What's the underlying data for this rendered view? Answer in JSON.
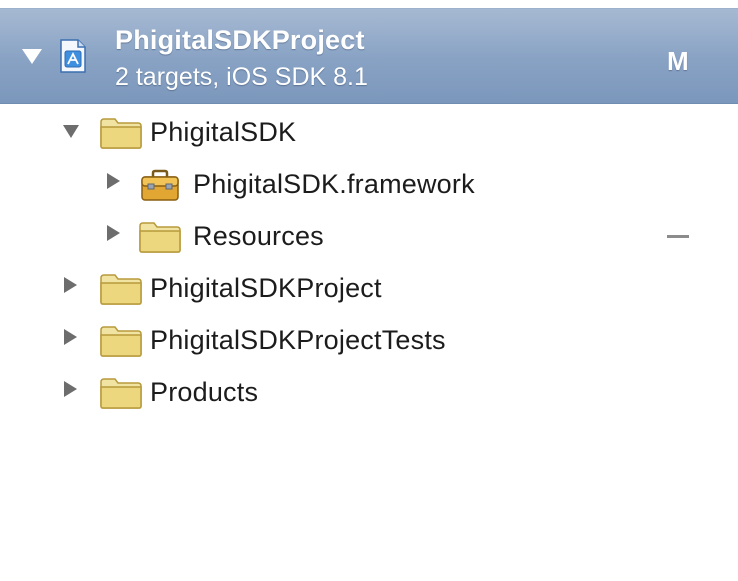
{
  "project": {
    "name": "PhigitalSDKProject",
    "subtitle": "2 targets, iOS SDK 8.1",
    "status": "M",
    "icon": "xcode-project-icon",
    "expanded": true
  },
  "tree": [
    {
      "label": "PhigitalSDK",
      "icon": "folder-icon",
      "expanded": true,
      "level": 1,
      "status": ""
    },
    {
      "label": "PhigitalSDK.framework",
      "icon": "framework-toolbox-icon",
      "expanded": false,
      "level": 2,
      "status": ""
    },
    {
      "label": "Resources",
      "icon": "folder-icon",
      "expanded": false,
      "level": 2,
      "status": "—"
    },
    {
      "label": "PhigitalSDKProject",
      "icon": "folder-icon",
      "expanded": false,
      "level": 1,
      "status": ""
    },
    {
      "label": "PhigitalSDKProjectTests",
      "icon": "folder-icon",
      "expanded": false,
      "level": 1,
      "status": ""
    },
    {
      "label": "Products",
      "icon": "folder-icon",
      "expanded": false,
      "level": 1,
      "status": ""
    }
  ],
  "colors": {
    "selection": "#88a2c4",
    "folder": "#e9d57d",
    "disclosure": "#6d6d6d"
  }
}
